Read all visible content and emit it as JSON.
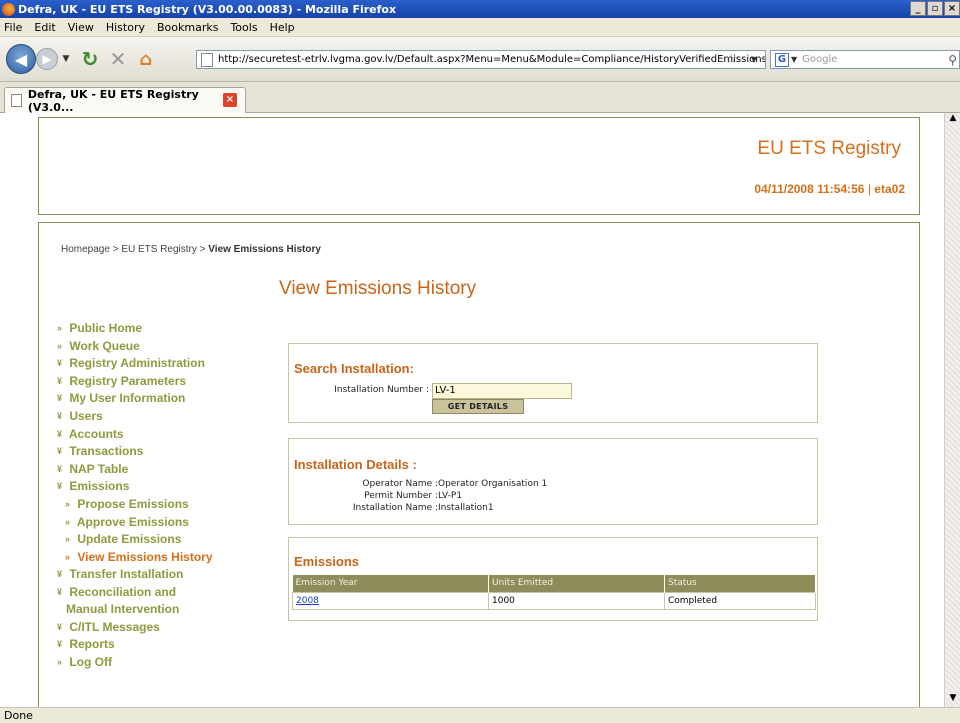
{
  "window": {
    "title": "Defra, UK - EU ETS Registry (V3.00.00.0083) - Mozilla Firefox"
  },
  "menubar": [
    "File",
    "Edit",
    "View",
    "History",
    "Bookmarks",
    "Tools",
    "Help"
  ],
  "browser": {
    "url": "http://securetest-etrlv.lvgma.gov.lv/Default.aspx?Menu=Menu&Module=Compliance/HistoryVerifiedEmissions",
    "search_engine": "Google",
    "tab_title": "Defra, UK - EU ETS Registry (V3.0...",
    "status": "Done"
  },
  "header": {
    "registry_title": "EU ETS Registry",
    "datetime": "04/11/2008 11:54:56",
    "separator": "|",
    "user": "eta02"
  },
  "breadcrumb": {
    "path": "Homepage > EU ETS Registry > ",
    "current": "View Emissions History"
  },
  "page_title": "View Emissions History",
  "nav": [
    {
      "label": "Public Home",
      "marker": "»"
    },
    {
      "label": "Work Queue",
      "marker": "»"
    },
    {
      "label": "Registry Administration",
      "marker": "¥"
    },
    {
      "label": "Registry Parameters",
      "marker": "¥"
    },
    {
      "label": "My User Information",
      "marker": "¥"
    },
    {
      "label": "Users",
      "marker": "¥"
    },
    {
      "label": "Accounts",
      "marker": "¥"
    },
    {
      "label": "Transactions",
      "marker": "¥"
    },
    {
      "label": "NAP Table",
      "marker": "¥"
    },
    {
      "label": "Emissions",
      "marker": "¥"
    },
    {
      "label": "Propose Emissions",
      "marker": "»"
    },
    {
      "label": "Approve Emissions",
      "marker": "»"
    },
    {
      "label": "Update Emissions",
      "marker": "»"
    },
    {
      "label": "View Emissions History",
      "marker": "»"
    },
    {
      "label": "Transfer Installation",
      "marker": "¥"
    },
    {
      "label": "Reconciliation and",
      "marker": "¥"
    },
    {
      "label": "Manual Intervention",
      "marker": ""
    },
    {
      "label": "C/ITL Messages",
      "marker": "¥"
    },
    {
      "label": "Reports",
      "marker": "¥"
    },
    {
      "label": "Log Off",
      "marker": "»"
    }
  ],
  "search": {
    "title": "Search Installation:",
    "label": "Installation Number :",
    "value": "LV-1",
    "button": "Get Details"
  },
  "details": {
    "title": "Installation Details :",
    "operator_label": "Operator Name :",
    "operator_value": "Operator Organisation 1",
    "permit_label": "Permit Number :",
    "permit_value": "LV-P1",
    "installation_label": "Installation Name :",
    "installation_value": "Installation1"
  },
  "emissions": {
    "title": "Emissions",
    "columns": [
      "Emission Year",
      "Units Emitted",
      "Status"
    ],
    "rows": [
      [
        "2008",
        "1000",
        "Completed"
      ]
    ]
  },
  "colors": {
    "accent": "#d4701a",
    "nav_green": "#8e9a3e",
    "table_header": "#8e8c5a"
  }
}
